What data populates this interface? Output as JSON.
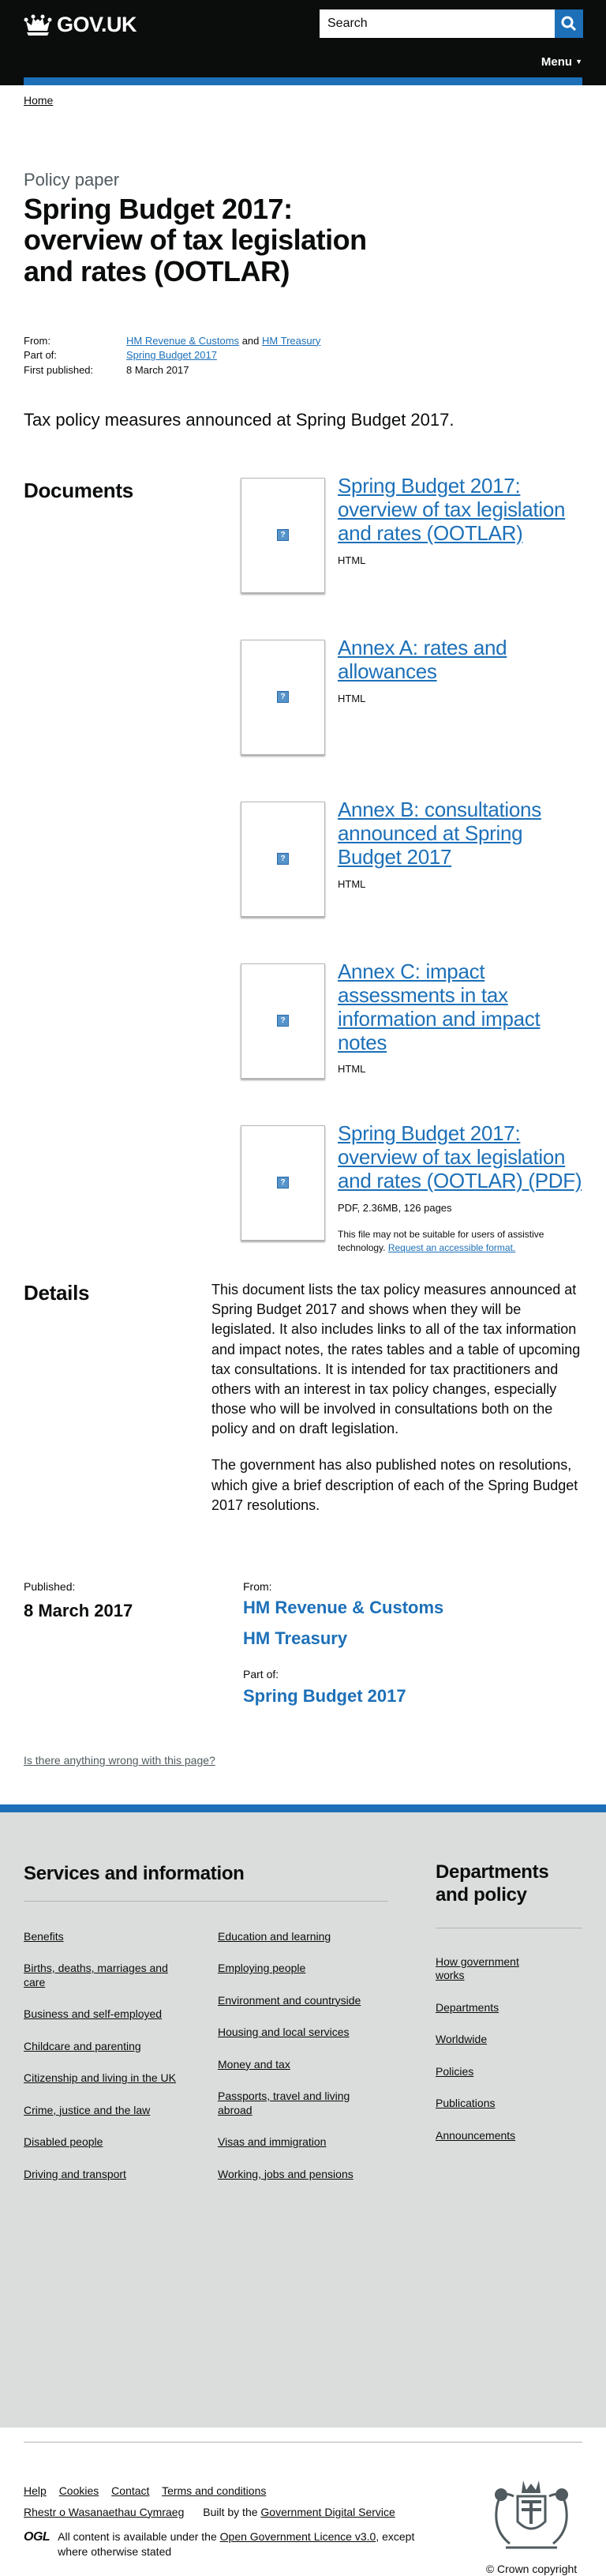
{
  "header": {
    "brand": "GOV.UK",
    "search_placeholder": "Search",
    "menu_label": "Menu"
  },
  "breadcrumb": {
    "home": "Home"
  },
  "page": {
    "context": "Policy paper",
    "title": "Spring Budget 2017: overview of tax legislation and rates (OOTLAR)",
    "meta": {
      "from_label": "From:",
      "from_org1": "HM Revenue & Customs",
      "from_and": "and",
      "from_org2": "HM Treasury",
      "partof_label": "Part of:",
      "partof_value": "Spring Budget 2017",
      "published_label": "First published:",
      "published_value": "8 March 2017"
    },
    "lede": "Tax policy measures announced at Spring Budget 2017."
  },
  "documents": {
    "heading": "Documents",
    "items": [
      {
        "title": "Spring Budget 2017: overview of tax legislation and rates (OOTLAR)",
        "meta": "HTML"
      },
      {
        "title": "Annex A: rates and allowances",
        "meta": "HTML"
      },
      {
        "title": "Annex B: consultations announced at Spring Budget 2017",
        "meta": "HTML"
      },
      {
        "title": "Annex C: impact assessments in tax information and impact notes",
        "meta": "HTML"
      },
      {
        "title": "Spring Budget 2017: overview of tax legislation and rates (OOTLAR) (PDF)",
        "meta": "PDF, 2.36MB, 126 pages",
        "note": "This file may not be suitable for users of assistive technology.",
        "note_link": "Request an accessible format."
      }
    ]
  },
  "details": {
    "heading": "Details",
    "p1": "This document lists the tax policy measures announced at Spring Budget 2017 and shows when they will be legislated. It also includes links to all of the tax information and impact notes, the rates tables and a table of upcoming tax consultations. It is intended for tax practitioners and others with an interest in tax policy changes, especially those who will be involved in consultations both on the policy and on draft legislation.",
    "p2": "The government has also published notes on resolutions, which give a brief description of each of the Spring Budget 2017 resolutions."
  },
  "published": {
    "label": "Published:",
    "date": "8 March 2017",
    "from_label": "From:",
    "org1": "HM Revenue & Customs",
    "org2": "HM Treasury",
    "partof_label": "Part of:",
    "partof": "Spring Budget 2017"
  },
  "report_link": "Is there anything wrong with this page?",
  "footer": {
    "services_heading": "Services and information",
    "services_col1": [
      "Benefits",
      "Births, deaths, marriages and care",
      "Business and self-employed",
      "Childcare and parenting",
      "Citizenship and living in the UK",
      "Crime, justice and the law",
      "Disabled people",
      "Driving and transport"
    ],
    "services_col2": [
      "Education and learning",
      "Employing people",
      "Environment and countryside",
      "Housing and local services",
      "Money and tax",
      "Passports, travel and living abroad",
      "Visas and immigration",
      "Working, jobs and pensions"
    ],
    "departments_heading": "Departments and policy",
    "departments": [
      "How government works",
      "Departments",
      "Worldwide",
      "Policies",
      "Publications",
      "Announcements"
    ],
    "links_row1": [
      "Help",
      "Cookies",
      "Contact",
      "Terms and conditions"
    ],
    "welsh": "Rhestr o Wasanaethau Cymraeg",
    "built_by_prefix": "Built by the",
    "built_by_link": "Government Digital Service",
    "ogl_mark": "OGL",
    "licence_prefix": "All content is available under the",
    "licence_link": "Open Government Licence v3.0",
    "licence_suffix": ", except where otherwise stated",
    "copyright": "© Crown copyright"
  }
}
